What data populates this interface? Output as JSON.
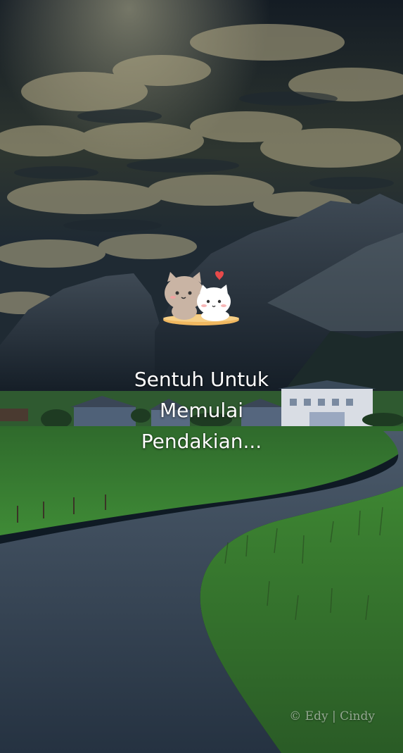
{
  "splash": {
    "cta_line1": "Sentuh Untuk",
    "cta_line2": "Memulai",
    "cta_line3": "Pendakian...",
    "watermark": "© Edy | Cindy"
  },
  "icons": {
    "mascot": "two-cats-hugging-icon",
    "heart": "heart-icon"
  },
  "colors": {
    "text": "#ffffff",
    "grass": "#3d8a34",
    "road": "#2b3a4a",
    "sky": "#1b2630",
    "heart": "#e84a4a",
    "cushion": "#f0b860"
  }
}
